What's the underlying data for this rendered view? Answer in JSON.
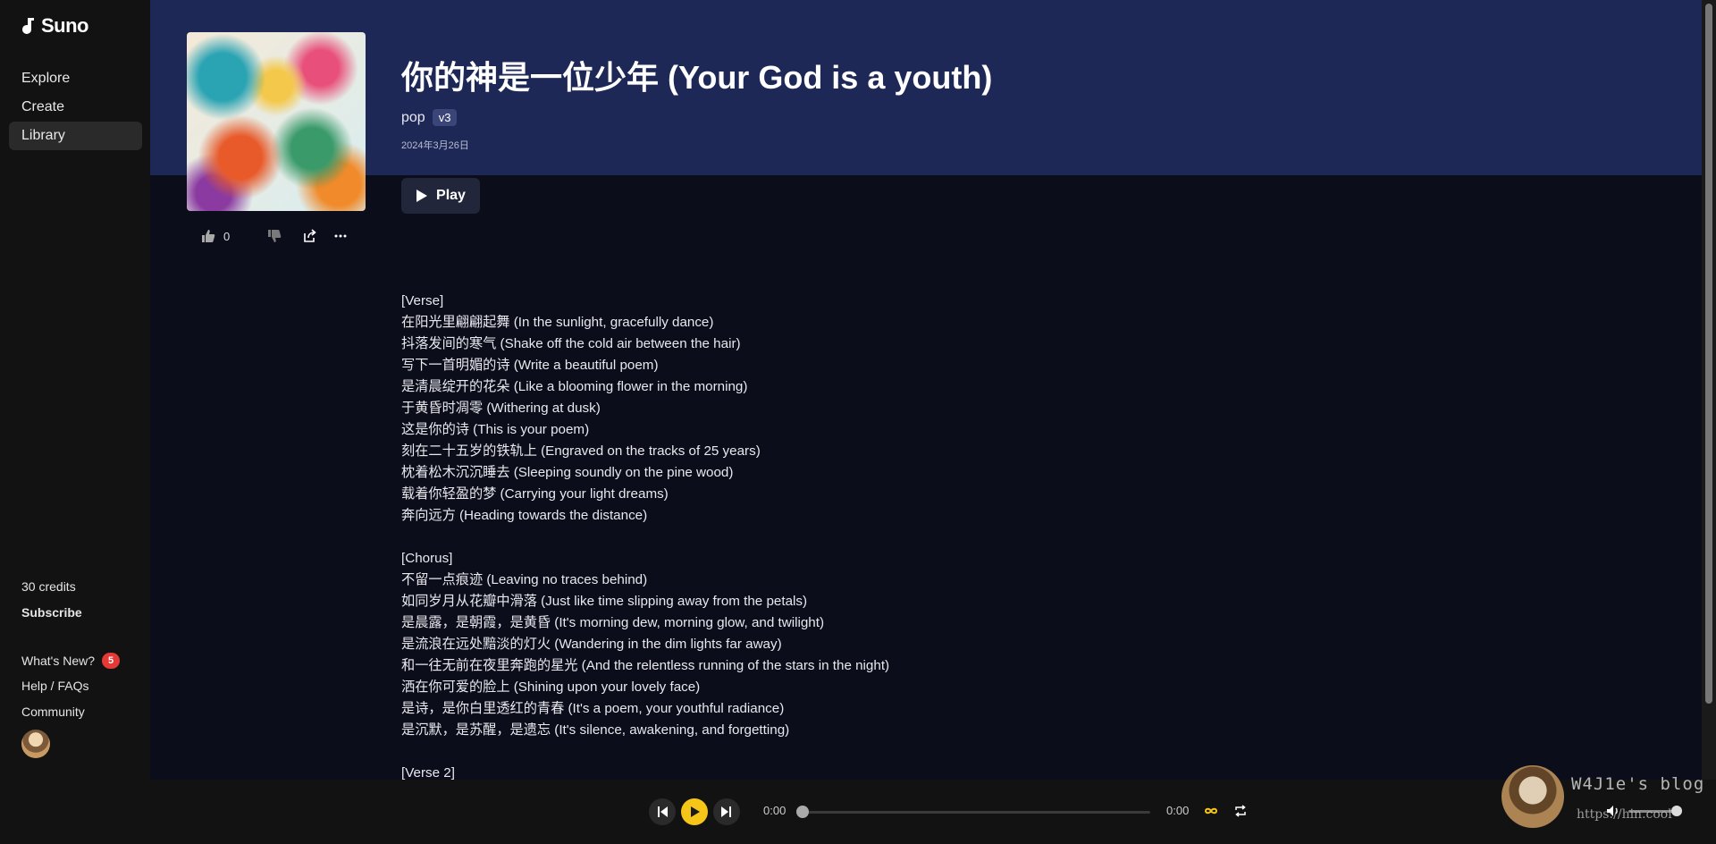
{
  "sidebar": {
    "logo": "Suno",
    "nav": [
      {
        "label": "Explore"
      },
      {
        "label": "Create"
      },
      {
        "label": "Library"
      }
    ],
    "credits": "30 credits",
    "subscribe": "Subscribe",
    "whats_new": "What's New?",
    "whats_new_badge": "5",
    "help": "Help / FAQs",
    "community": "Community"
  },
  "song": {
    "title": "你的神是一位少年 (Your God is a youth)",
    "genre": "pop",
    "version": "v3",
    "date": "2024年3月26日",
    "play_label": "Play",
    "like_count": "0"
  },
  "lyrics": [
    "[Verse]",
    "在阳光里翩翩起舞 (In the sunlight, gracefully dance)",
    "抖落发间的寒气 (Shake off the cold air between the hair)",
    "写下一首明媚的诗 (Write a beautiful poem)",
    "是清晨绽开的花朵 (Like a blooming flower in the morning)",
    "于黄昏时凋零 (Withering at dusk)",
    "这是你的诗 (This is your poem)",
    "刻在二十五岁的铁轨上 (Engraved on the tracks of 25 years)",
    "枕着松木沉沉睡去 (Sleeping soundly on the pine wood)",
    "载着你轻盈的梦 (Carrying your light dreams)",
    "奔向远方 (Heading towards the distance)",
    "",
    "[Chorus]",
    "不留一点痕迹 (Leaving no traces behind)",
    "如同岁月从花瓣中滑落 (Just like time slipping away from the petals)",
    "是晨露，是朝霞，是黄昏 (It's morning dew, morning glow, and twilight)",
    "是流浪在远处黯淡的灯火 (Wandering in the dim lights far away)",
    "和一往无前在夜里奔跑的星光 (And the relentless running of the stars in the night)",
    "洒在你可爱的脸上 (Shining upon your lovely face)",
    "是诗，是你白里透红的青春 (It's a poem, your youthful radiance)",
    "是沉默，是苏醒，是遗忘 (It's silence, awakening, and forgetting)",
    "",
    "[Verse 2]"
  ],
  "player": {
    "current_time": "0:00",
    "duration": "0:00",
    "progress": 0,
    "volume": 0.9
  },
  "watermark": {
    "name": "W4J1e's blog",
    "url": "https://hin.cool"
  },
  "colors": {
    "hero_bg": "#1e2857",
    "page_bg": "#0b0d1a",
    "play_accent": "#f5c518",
    "badge": "#e53935"
  }
}
